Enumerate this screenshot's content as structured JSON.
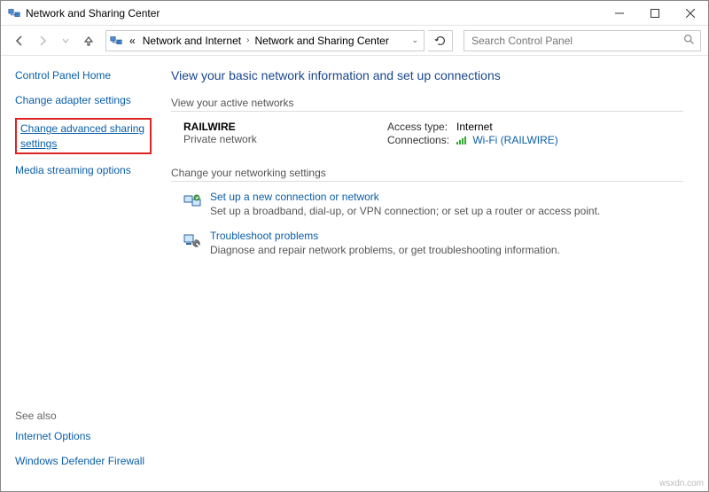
{
  "window": {
    "title": "Network and Sharing Center"
  },
  "toolbar": {
    "breadcrumb_prefix": "«",
    "crumb1": "Network and Internet",
    "crumb2": "Network and Sharing Center",
    "search_placeholder": "Search Control Panel"
  },
  "sidebar": {
    "home": "Control Panel Home",
    "links": {
      "adapter": "Change adapter settings",
      "advanced": "Change advanced sharing settings",
      "media": "Media streaming options"
    },
    "seealso_label": "See also",
    "seealso": {
      "inetopt": "Internet Options",
      "firewall": "Windows Defender Firewall"
    }
  },
  "main": {
    "heading": "View your basic network information and set up connections",
    "active_label": "View your active networks",
    "network": {
      "name": "RAILWIRE",
      "type": "Private network",
      "access_label": "Access type:",
      "access_value": "Internet",
      "conn_label": "Connections:",
      "conn_link": "Wi-Fi (RAILWIRE)"
    },
    "change_label": "Change your networking settings",
    "setup": {
      "title": "Set up a new connection or network",
      "desc": "Set up a broadband, dial-up, or VPN connection; or set up a router or access point."
    },
    "trouble": {
      "title": "Troubleshoot problems",
      "desc": "Diagnose and repair network problems, or get troubleshooting information."
    }
  },
  "watermark": "wsxdn.com"
}
